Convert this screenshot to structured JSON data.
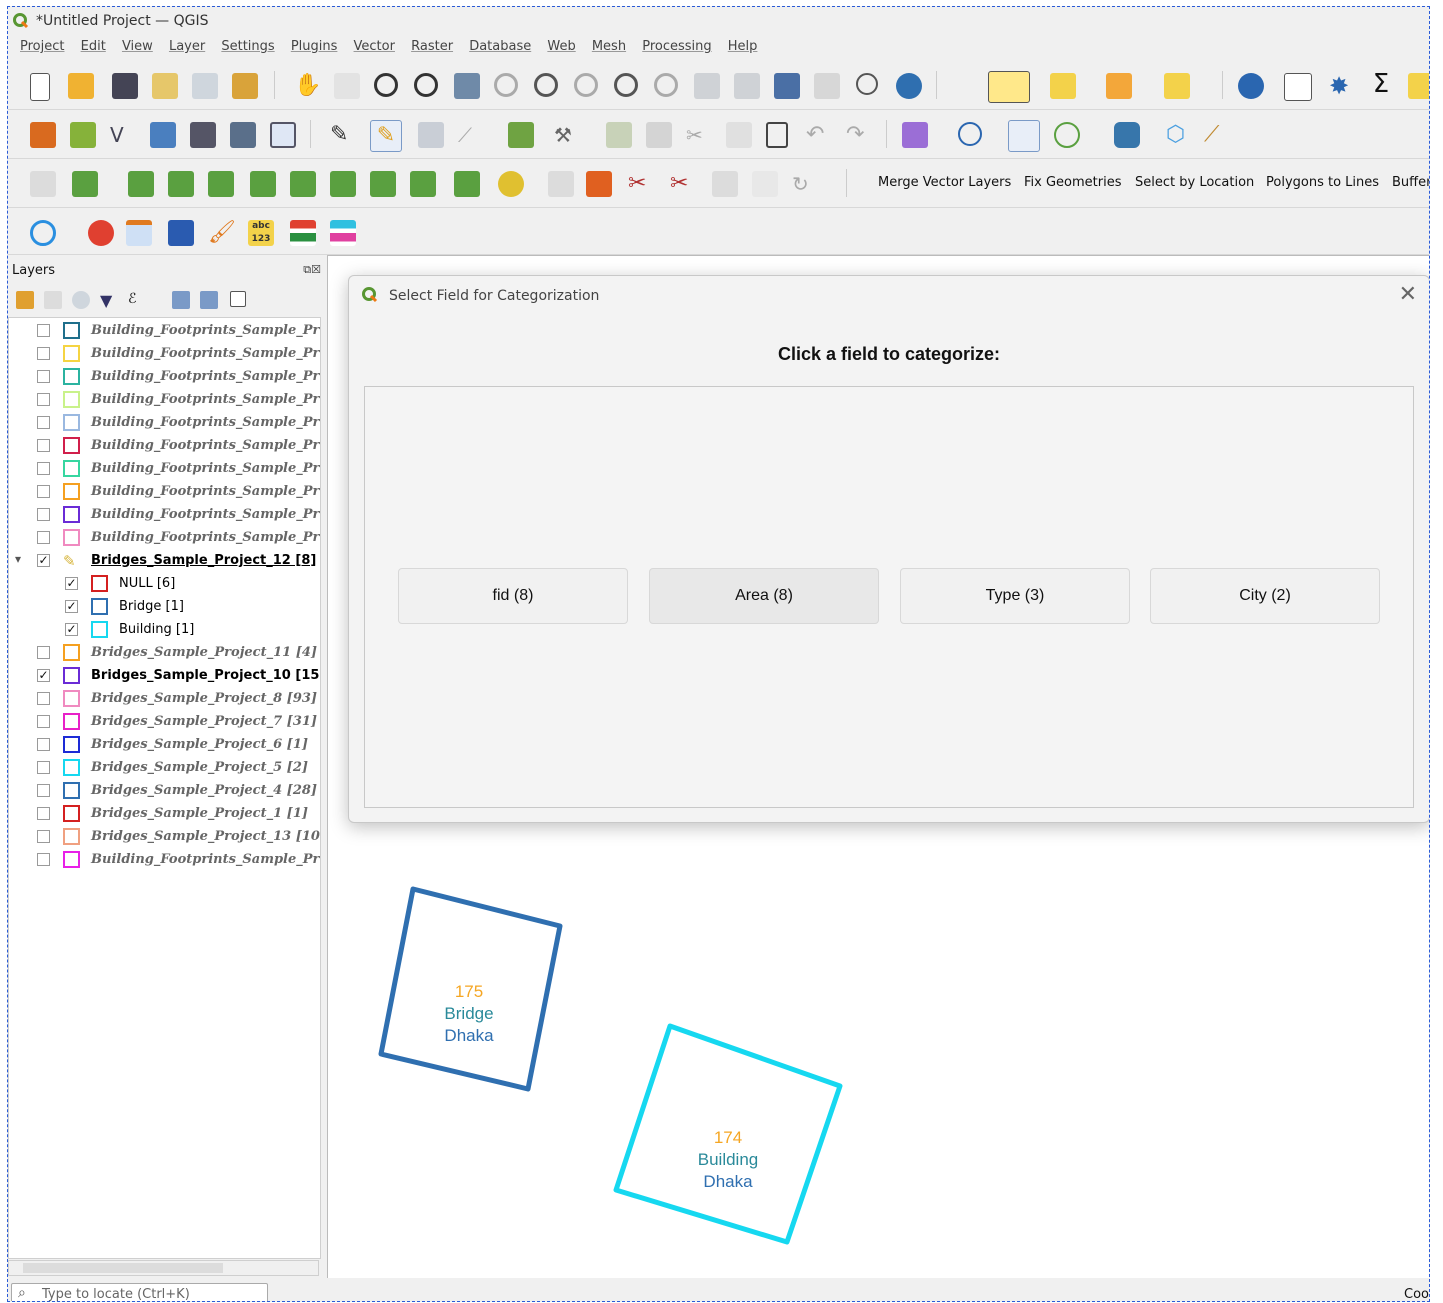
{
  "window": {
    "title": "*Untitled Project — QGIS"
  },
  "menu": [
    "Project",
    "Edit",
    "View",
    "Layer",
    "Settings",
    "Plugins",
    "Vector",
    "Raster",
    "Database",
    "Web",
    "Mesh",
    "Processing",
    "Help"
  ],
  "toolbar3_text_buttons": [
    "Merge Vector Layers",
    "Fix Geometries",
    "Select by Location",
    "Polygons to Lines",
    "Buffer"
  ],
  "layers_panel": {
    "title": "Layers",
    "items": [
      {
        "name": "Building_Footprints_Sample_Pr",
        "checked": false,
        "color": "#1f6f8b"
      },
      {
        "name": "Building_Footprints_Sample_Pr",
        "checked": false,
        "color": "#f5d442"
      },
      {
        "name": "Building_Footprints_Sample_Pr",
        "checked": false,
        "color": "#2bb3a0"
      },
      {
        "name": "Building_Footprints_Sample_Pr",
        "checked": false,
        "color": "#c9f28a"
      },
      {
        "name": "Building_Footprints_Sample_Pr",
        "checked": false,
        "color": "#9ab8e0"
      },
      {
        "name": "Building_Footprints_Sample_Pr",
        "checked": false,
        "color": "#d11f4b"
      },
      {
        "name": "Building_Footprints_Sample_Pr",
        "checked": false,
        "color": "#36d6a0"
      },
      {
        "name": "Building_Footprints_Sample_Pr",
        "checked": false,
        "color": "#f5a020"
      },
      {
        "name": "Building_Footprints_Sample_Pr",
        "checked": false,
        "color": "#6a2bd6"
      },
      {
        "name": "Building_Footprints_Sample_Pr",
        "checked": false,
        "color": "#f08ac0"
      },
      {
        "name": "Bridges_Sample_Project_12 [8]",
        "checked": true,
        "group": true
      },
      {
        "name": "NULL [6]",
        "checked": true,
        "color": "#d42020",
        "sub": true
      },
      {
        "name": "Bridge [1]",
        "checked": true,
        "color": "#2f6fb0",
        "sub": true
      },
      {
        "name": "Building [1]",
        "checked": true,
        "color": "#16d8f0",
        "sub": true
      },
      {
        "name": "Bridges_Sample_Project_11 [4]",
        "checked": false,
        "color": "#f5a020"
      },
      {
        "name": "Bridges_Sample_Project_10 [15",
        "checked": true,
        "color": "#6a2bd6",
        "on": true
      },
      {
        "name": "Bridges_Sample_Project_8 [93]",
        "checked": false,
        "color": "#f08ac0"
      },
      {
        "name": "Bridges_Sample_Project_7 [31]",
        "checked": false,
        "color": "#e820c8"
      },
      {
        "name": "Bridges_Sample_Project_6 [1]",
        "checked": false,
        "color": "#1d2bd6"
      },
      {
        "name": "Bridges_Sample_Project_5 [2]",
        "checked": false,
        "color": "#16d8f0"
      },
      {
        "name": "Bridges_Sample_Project_4 [28]",
        "checked": false,
        "color": "#2f6fb0"
      },
      {
        "name": "Bridges_Sample_Project_1 [1]",
        "checked": false,
        "color": "#d42020"
      },
      {
        "name": "Bridges_Sample_Project_13 [10",
        "checked": false,
        "color": "#f0a080"
      },
      {
        "name": "Building_Footprints_Sample_Pr",
        "checked": false,
        "color": "#e820e8"
      }
    ]
  },
  "dialog": {
    "title": "Select Field for Categorization",
    "prompt": "Click a field to categorize:",
    "fields": [
      "fid (8)",
      "Area (8)",
      "Type (3)",
      "City (2)"
    ]
  },
  "map_features": [
    {
      "id": "175",
      "type": "Bridge",
      "city": "Dhaka",
      "color": "#2f6fb0"
    },
    {
      "id": "174",
      "type": "Building",
      "city": "Dhaka",
      "color": "#16d8f0"
    }
  ],
  "status": {
    "locate_placeholder": "Type to locate (Ctrl+K)",
    "coord_label": "Coo"
  }
}
